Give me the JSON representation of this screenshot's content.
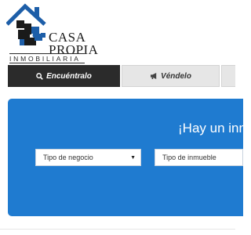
{
  "brand": {
    "line1": "CASA",
    "line2": "PROPIA",
    "subtitle": "INMOBILIARIA"
  },
  "tabs": [
    {
      "label": "Encuéntralo",
      "icon": "search-icon",
      "active": true
    },
    {
      "label": "Véndelo",
      "icon": "megaphone-icon",
      "active": false
    }
  ],
  "hero": {
    "title": "¡Hay un inm",
    "selects": [
      {
        "value": "Tipo de negocio"
      },
      {
        "value": "Tipo de inmueble"
      }
    ]
  },
  "colors": {
    "hero": "#1f7bd0",
    "logo_blue": "#1d5ea8",
    "tab_active": "#2b2b2b",
    "tab_inactive": "#e6e6e6"
  }
}
